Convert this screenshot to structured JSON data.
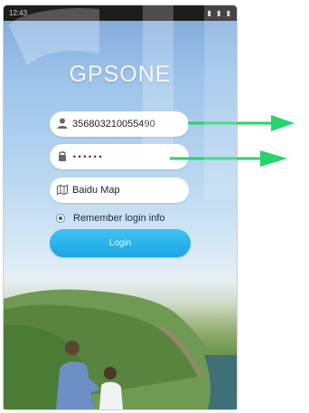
{
  "status_bar": {
    "time": "12:43",
    "indicators": "▮ ▮ ▮"
  },
  "app": {
    "title": "GPSONE"
  },
  "login_form": {
    "imei_value": "356803210055490",
    "password_value": "••••••",
    "map_value": "Baidu Map",
    "remember_label": "Remember login info",
    "remember_checked": true,
    "login_label": "Login"
  },
  "icons": {
    "imei": "user-icon",
    "password": "lock-icon",
    "map": "map-icon",
    "annotation": "arrow-right-icon"
  },
  "colors": {
    "accent": "#1aa5e6",
    "annotation_arrow": "#27d36a",
    "title_text": "#ffffff"
  }
}
